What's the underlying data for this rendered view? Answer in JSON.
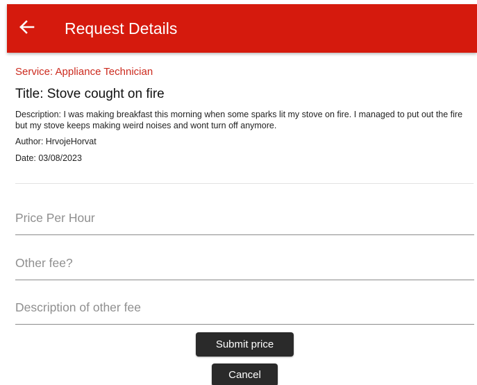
{
  "header": {
    "title": "Request Details",
    "back_icon": "arrow-left-icon",
    "background_color": "#d51a0d"
  },
  "request": {
    "service": "Service: Appliance Technician",
    "title": "Title: Stove cought on fire",
    "description": "Description: I was making breakfast this morning when some sparks lit my stove on fire.  I managed to put out the fire but my stove keeps making weird noises and wont turn off anymore.",
    "author": "Author: HrvojeHorvat",
    "date": "Date: 03/08/2023"
  },
  "form": {
    "price_per_hour": {
      "placeholder": "Price Per Hour",
      "value": ""
    },
    "other_fee": {
      "placeholder": "Other fee?",
      "value": ""
    },
    "other_fee_description": {
      "placeholder": "Description of other fee",
      "value": ""
    }
  },
  "actions": {
    "submit_label": "Submit price",
    "cancel_label": "Cancel"
  }
}
